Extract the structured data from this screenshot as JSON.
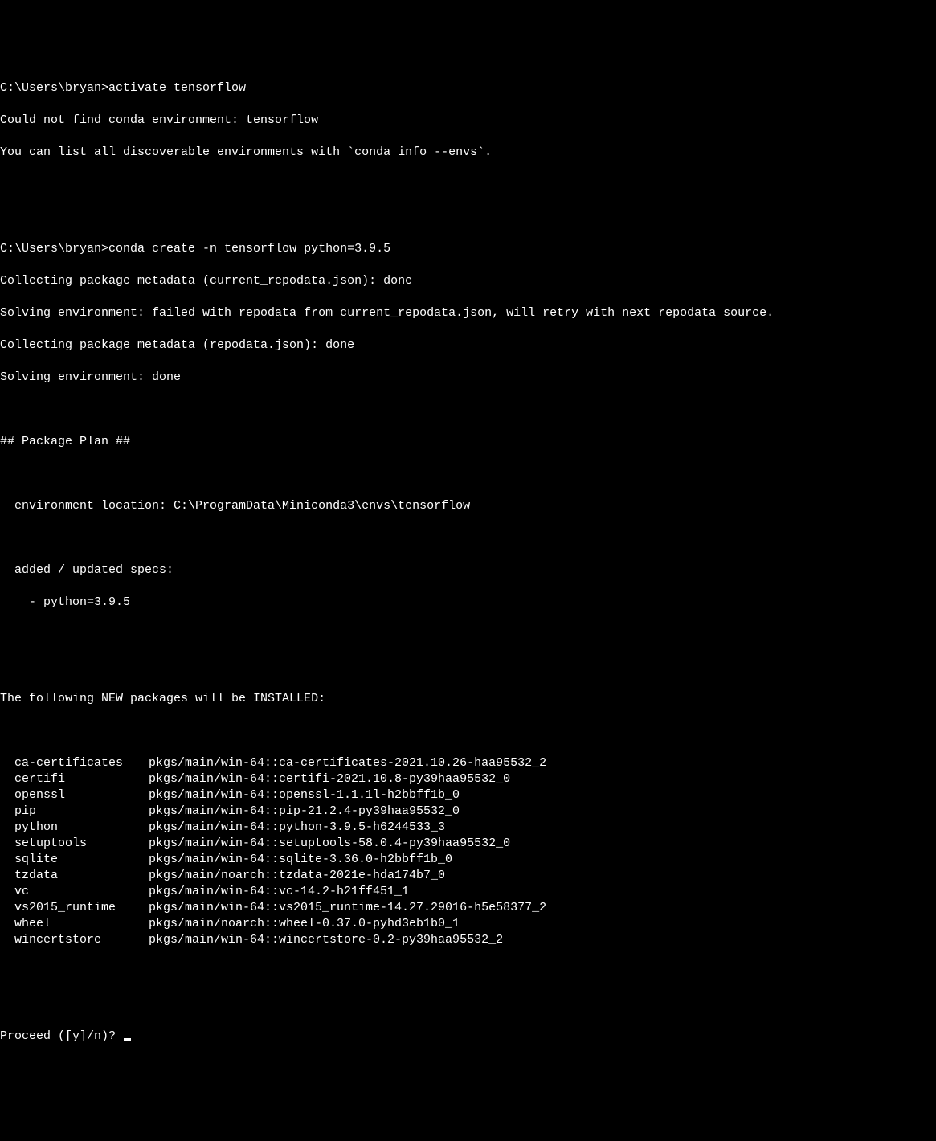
{
  "prompt1": "C:\\Users\\bryan>",
  "cmd1": "activate tensorflow",
  "err1": "Could not find conda environment: tensorflow",
  "err2": "You can list all discoverable environments with `conda info --envs`.",
  "prompt2": "C:\\Users\\bryan>",
  "cmd2": "conda create -n tensorflow python=3.9.5",
  "out1": "Collecting package metadata (current_repodata.json): done",
  "out2": "Solving environment: failed with repodata from current_repodata.json, will retry with next repodata source.",
  "out3": "Collecting package metadata (repodata.json): done",
  "out4": "Solving environment: done",
  "planHeader": "## Package Plan ##",
  "envLoc": "  environment location: C:\\ProgramData\\Miniconda3\\envs\\tensorflow",
  "specsHeader": "  added / updated specs:",
  "spec1": "    - python=3.9.5",
  "newPkgHeader": "The following NEW packages will be INSTALLED:",
  "packages": [
    {
      "name": "ca-certificates",
      "spec": "pkgs/main/win-64::ca-certificates-2021.10.26-haa95532_2"
    },
    {
      "name": "certifi",
      "spec": "pkgs/main/win-64::certifi-2021.10.8-py39haa95532_0"
    },
    {
      "name": "openssl",
      "spec": "pkgs/main/win-64::openssl-1.1.1l-h2bbff1b_0"
    },
    {
      "name": "pip",
      "spec": "pkgs/main/win-64::pip-21.2.4-py39haa95532_0"
    },
    {
      "name": "python",
      "spec": "pkgs/main/win-64::python-3.9.5-h6244533_3"
    },
    {
      "name": "setuptools",
      "spec": "pkgs/main/win-64::setuptools-58.0.4-py39haa95532_0"
    },
    {
      "name": "sqlite",
      "spec": "pkgs/main/win-64::sqlite-3.36.0-h2bbff1b_0"
    },
    {
      "name": "tzdata",
      "spec": "pkgs/main/noarch::tzdata-2021e-hda174b7_0"
    },
    {
      "name": "vc",
      "spec": "pkgs/main/win-64::vc-14.2-h21ff451_1"
    },
    {
      "name": "vs2015_runtime",
      "spec": "pkgs/main/win-64::vs2015_runtime-14.27.29016-h5e58377_2"
    },
    {
      "name": "wheel",
      "spec": "pkgs/main/noarch::wheel-0.37.0-pyhd3eb1b0_1"
    },
    {
      "name": "wincertstore",
      "spec": "pkgs/main/win-64::wincertstore-0.2-py39haa95532_2"
    }
  ],
  "proceedPrompt": "Proceed ([y]/n)? "
}
